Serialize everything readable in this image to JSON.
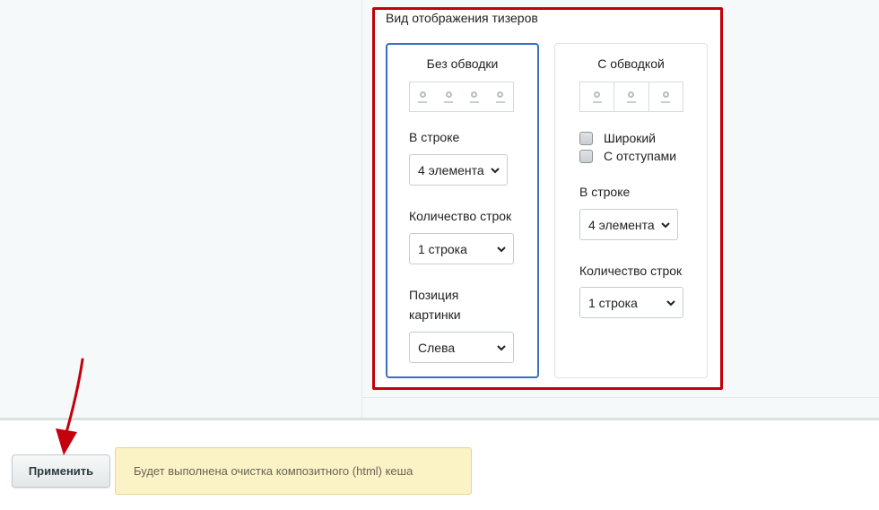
{
  "section": {
    "title": "Вид отображения тизеров"
  },
  "card_plain": {
    "title": "Без обводки",
    "per_row_label": "В строке",
    "per_row_value": "4 элемента",
    "rows_label": "Количество строк",
    "rows_value": "1 строка",
    "image_position_label": "Позиция картинки",
    "image_position_value": "Слева"
  },
  "card_bordered": {
    "title": "С обводкой",
    "wide_label": "Широкий",
    "wide_checked": false,
    "padded_label": "С отступами",
    "padded_checked": false,
    "per_row_label": "В строке",
    "per_row_value": "4 элемента",
    "rows_label": "Количество строк",
    "rows_value": "1 строка"
  },
  "footer": {
    "apply_label": "Применить",
    "notice_text": "Будет выполнена очистка композитного (html) кеша"
  },
  "colors": {
    "highlight_frame": "#c4000d",
    "selected_card_border": "#3c6fc2",
    "notice_background": "#fbf2c6",
    "annotation_arrow": "#c4000d"
  },
  "icons": {
    "select_chevron": "chevron-down-icon",
    "preview_item": "teaser-item-icon",
    "annotation": "red-arrow-annotation"
  }
}
